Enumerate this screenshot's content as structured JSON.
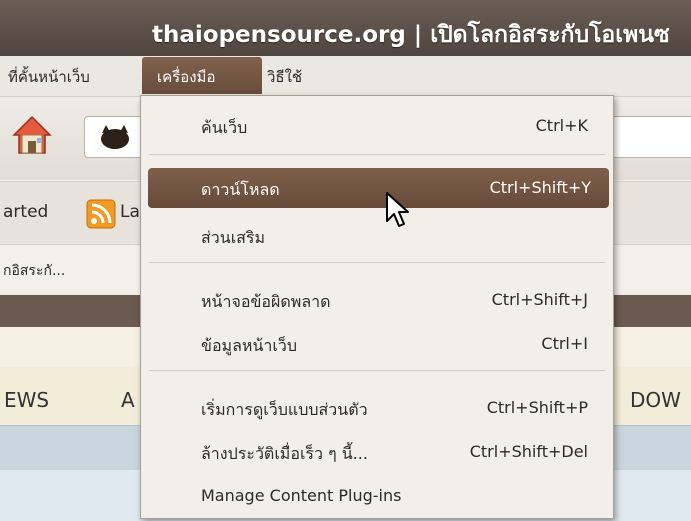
{
  "window": {
    "title": "thaiopensource.org | เปิดโลกอิสระกับโอเพนซ"
  },
  "menubar": {
    "items": [
      {
        "label": "ที่คั้นหน้าเว็บ"
      },
      {
        "label": "เครื่องมือ"
      },
      {
        "label": "วิธีใช้"
      }
    ]
  },
  "bookmarks": {
    "left_text": "arted",
    "item2": "La"
  },
  "tab": {
    "label": "กอิสระกั..."
  },
  "page_nav": {
    "left": "EWS",
    "mid": "A",
    "right": "DOW"
  },
  "tools_menu": {
    "items": [
      {
        "label": "ค้นเว็บ",
        "accel": "Ctrl+K"
      },
      {
        "label": "ดาวน์โหลด",
        "accel": "Ctrl+Shift+Y"
      },
      {
        "label": "ส่วนเสริม",
        "accel": ""
      },
      {
        "label": "หน้าจอข้อผิดพลาด",
        "accel": "Ctrl+Shift+J"
      },
      {
        "label": "ข้อมูลหน้าเว็บ",
        "accel": "Ctrl+I"
      },
      {
        "label": "เริ่มการดูเว็บแบบส่วนตัว",
        "accel": "Ctrl+Shift+P"
      },
      {
        "label": "ล้างประวัติเมื่อเร็ว ๆ นี้...",
        "accel": "Ctrl+Shift+Del"
      },
      {
        "label": "Manage Content Plug-ins",
        "accel": ""
      }
    ],
    "highlighted": "ดาวน์โหลด"
  },
  "colors": {
    "highlight": "#6f5140",
    "menu_bg": "#f2efea",
    "title_bg": "#4d433d"
  }
}
